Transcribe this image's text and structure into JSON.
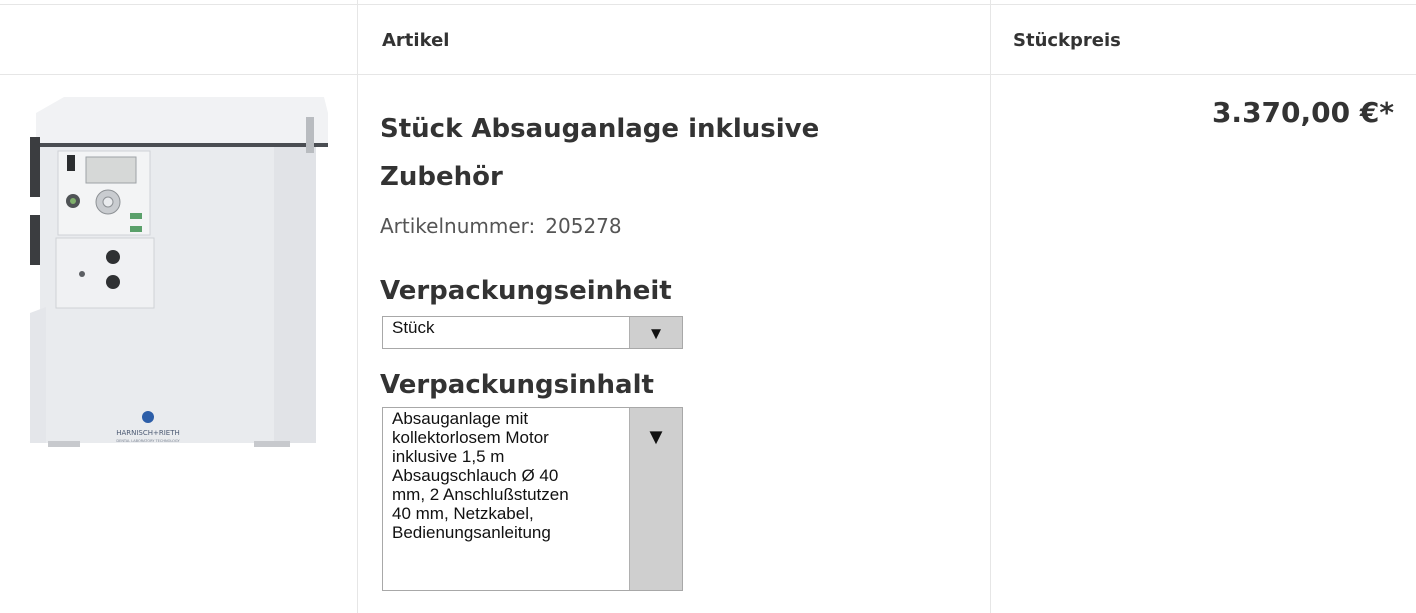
{
  "table": {
    "headers": {
      "article": "Artikel",
      "unit_price": "Stückpreis"
    }
  },
  "product": {
    "title": "Stück Absauganlage inklusive Zubehör",
    "article_number_label": "Artikelnummer:",
    "article_number": "205278",
    "price": "3.370,00 €*",
    "image_brand_text": "HARNISCH+RIETH",
    "image_brand_subtext": "DENTAL LABORATORY TECHNOLOGY"
  },
  "packaging_unit": {
    "label": "Verpackungseinheit",
    "selected": "Stück"
  },
  "packaging_content": {
    "label": "Verpackungsinhalt",
    "selected_lines": [
      "Absauganlage mit",
      "kollektorlosem Motor",
      "inklusive 1,5 m",
      "Absaugschlauch Ø 40",
      "mm, 2 Anschlußstutzen",
      "40 mm, Netzkabel,",
      "Bedienungsanleitung"
    ]
  },
  "icons": {
    "dropdown": "triangle-down-icon"
  },
  "colors": {
    "border": "#e6e6e6",
    "select_button": "#cfcfcf",
    "text": "#333333"
  }
}
